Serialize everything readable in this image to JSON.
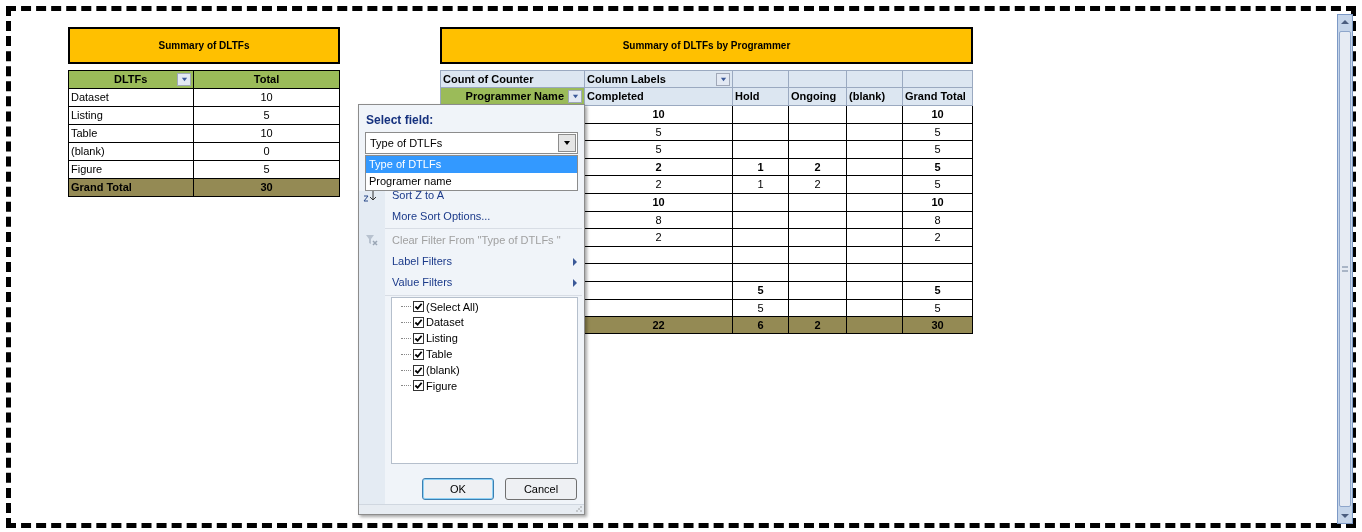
{
  "summary_table": {
    "title": "Summary of DLTFs",
    "columns": [
      {
        "label": "DLTFs",
        "has_filter": true
      },
      {
        "label": "Total",
        "has_filter": false
      }
    ],
    "rows": [
      {
        "label": "Dataset",
        "total": "10"
      },
      {
        "label": "Listing",
        "total": "5"
      },
      {
        "label": "Table",
        "total": "10"
      },
      {
        "label": "(blank)",
        "total": "0"
      },
      {
        "label": "Figure",
        "total": "5"
      }
    ],
    "grand_total": {
      "label": "Grand Total",
      "total": "30"
    }
  },
  "pivot_table": {
    "title": "Summary of DLTFs by Programmer",
    "corner_label": "Count of Counter",
    "column_labels_header": "Column Labels",
    "row_field": "Programmer Name",
    "columns": [
      "Completed",
      "Hold",
      "Ongoing",
      "(blank)",
      "Grand Total"
    ],
    "rows": [
      {
        "kind": "group",
        "completed": "10",
        "grand_total": "10"
      },
      {
        "kind": "item",
        "completed": "5",
        "grand_total": "5"
      },
      {
        "kind": "item",
        "completed": "5",
        "grand_total": "5"
      },
      {
        "kind": "group",
        "completed": "2",
        "hold": "1",
        "ongoing": "2",
        "grand_total": "5"
      },
      {
        "kind": "item",
        "completed": "2",
        "hold": "1",
        "ongoing": "2",
        "grand_total": "5"
      },
      {
        "kind": "group",
        "completed": "10",
        "grand_total": "10"
      },
      {
        "kind": "item",
        "completed": "8",
        "grand_total": "8"
      },
      {
        "kind": "item",
        "completed": "2",
        "grand_total": "2"
      },
      {
        "kind": "group"
      },
      {
        "kind": "item"
      },
      {
        "kind": "group",
        "hold": "5",
        "grand_total": "5"
      },
      {
        "kind": "item",
        "hold": "5",
        "grand_total": "5"
      }
    ],
    "grand_total": {
      "completed": "22",
      "hold": "6",
      "ongoing": "2",
      "grand_total": "30"
    }
  },
  "filter_menu": {
    "select_field_label": "Select field:",
    "field_value": "Type of DTLFs",
    "field_options": [
      {
        "label": "Type of DTLFs",
        "selected": true
      },
      {
        "label": "Programer name",
        "selected": false
      }
    ],
    "menu_items": [
      {
        "kind": "sort",
        "label": "Sort Z to A",
        "disabled": false,
        "submenu": false
      },
      {
        "kind": "plain",
        "label": "More Sort Options...",
        "disabled": false,
        "submenu": false
      },
      {
        "kind": "clear",
        "label": "Clear Filter From \"Type of DTLFs \"",
        "disabled": true,
        "submenu": false
      },
      {
        "kind": "plain",
        "label": "Label Filters",
        "disabled": false,
        "submenu": true
      },
      {
        "kind": "plain",
        "label": "Value Filters",
        "disabled": false,
        "submenu": true
      }
    ],
    "checklist": [
      {
        "label": "(Select All)",
        "checked": true
      },
      {
        "label": "Dataset",
        "checked": true
      },
      {
        "label": "Listing",
        "checked": true
      },
      {
        "label": "Table",
        "checked": true
      },
      {
        "label": "(blank)",
        "checked": true
      },
      {
        "label": "Figure",
        "checked": true
      }
    ],
    "buttons": [
      {
        "label": "OK",
        "default": true
      },
      {
        "label": "Cancel",
        "default": false
      }
    ]
  }
}
